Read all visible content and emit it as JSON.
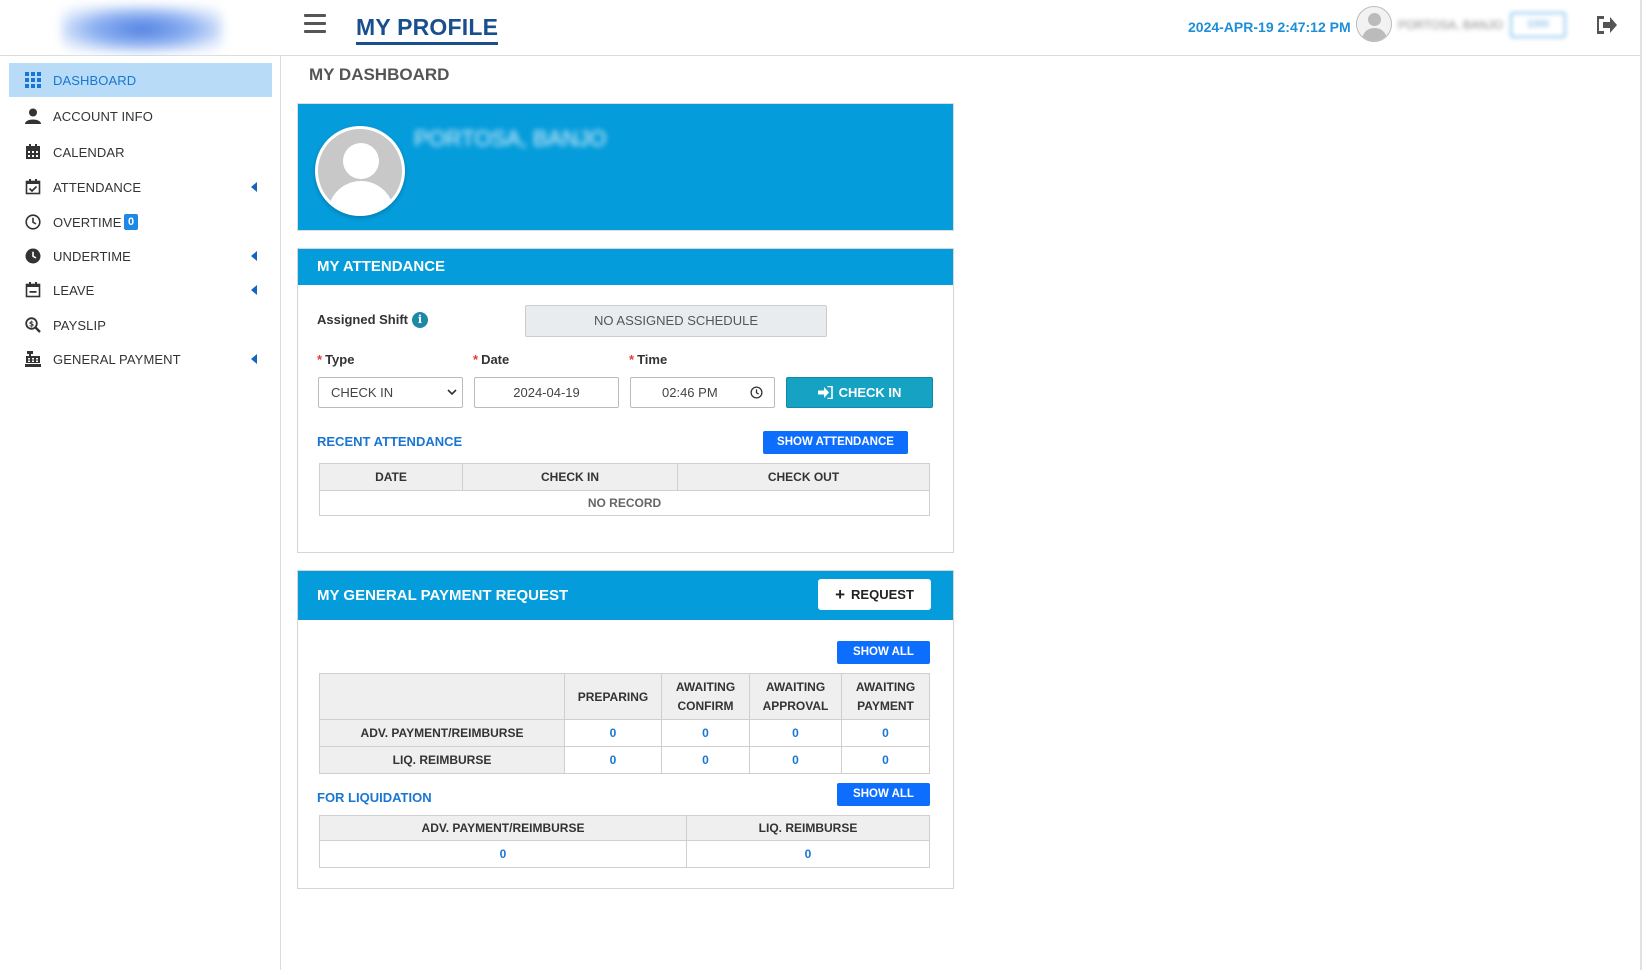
{
  "header": {
    "page_title": "MY PROFILE",
    "datetime": "2024-APR-19 2:47:12 PM",
    "user_name": "PORTOSA, BANJO",
    "user_badge": "1000"
  },
  "sidebar": {
    "items": [
      {
        "label": "DASHBOARD",
        "icon": "grid-icon",
        "active": true
      },
      {
        "label": "ACCOUNT INFO",
        "icon": "user-icon"
      },
      {
        "label": "CALENDAR",
        "icon": "calendar-icon"
      },
      {
        "label": "ATTENDANCE",
        "icon": "calendar-check-icon",
        "expandable": true
      },
      {
        "label": "OVERTIME",
        "icon": "clock-icon",
        "badge": "0"
      },
      {
        "label": "UNDERTIME",
        "icon": "clock-filled-icon",
        "expandable": true
      },
      {
        "label": "LEAVE",
        "icon": "calendar-minus-icon",
        "expandable": true
      },
      {
        "label": "PAYSLIP",
        "icon": "search-dollar-icon"
      },
      {
        "label": "GENERAL PAYMENT",
        "icon": "cash-register-icon",
        "expandable": true
      }
    ]
  },
  "main": {
    "section_title": "MY DASHBOARD",
    "profile": {
      "name": "PORTOSA, BANJO"
    },
    "attendance": {
      "title": "MY ATTENDANCE",
      "assigned_shift_label": "Assigned Shift",
      "assigned_shift_value": "NO ASSIGNED SCHEDULE",
      "type_label": "Type",
      "type_value": "CHECK IN",
      "date_label": "Date",
      "date_value": "2024-04-19",
      "time_label": "Time",
      "time_value": "02:46 PM",
      "check_in_button": "CHECK IN",
      "recent_title": "RECENT ATTENDANCE",
      "show_button": "SHOW ATTENDANCE",
      "columns": [
        "DATE",
        "CHECK IN",
        "CHECK OUT"
      ],
      "empty_text": "NO RECORD"
    },
    "payment": {
      "title": "MY GENERAL PAYMENT REQUEST",
      "request_button": "REQUEST",
      "show_all_button": "SHOW ALL",
      "columns": [
        "PREPARING",
        "AWAITING CONFIRM",
        "AWAITING APPROVAL",
        "AWAITING PAYMENT"
      ],
      "rows": [
        {
          "label": "ADV. PAYMENT/REIMBURSE",
          "values": [
            "0",
            "0",
            "0",
            "0"
          ]
        },
        {
          "label": "LIQ. REIMBURSE",
          "values": [
            "0",
            "0",
            "0",
            "0"
          ]
        }
      ],
      "liquidation_title": "FOR LIQUIDATION",
      "liquidation_show_all": "SHOW ALL",
      "liquidation_columns": [
        "ADV. PAYMENT/REIMBURSE",
        "LIQ. REIMBURSE"
      ],
      "liquidation_values": [
        "0",
        "0"
      ]
    }
  },
  "colors": {
    "accent": "#049cdb",
    "primary_button": "#0d6efd",
    "checkin_button": "#15a2c3",
    "title": "#1a4f8f",
    "active_nav": "#b8dcf8"
  }
}
